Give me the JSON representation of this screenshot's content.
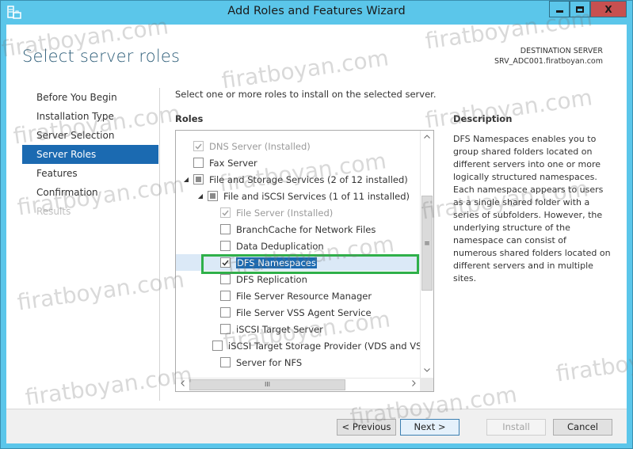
{
  "window": {
    "title": "Add Roles and Features Wizard",
    "controls": {
      "minimize": "minimize",
      "maximize": "maximize",
      "close": "X"
    }
  },
  "header": {
    "page_title": "Select server roles",
    "destination_label": "DESTINATION SERVER",
    "destination_server": "SRV_ADC001.firatboyan.com"
  },
  "nav": {
    "items": [
      {
        "label": "Before You Begin",
        "state": "normal"
      },
      {
        "label": "Installation Type",
        "state": "normal"
      },
      {
        "label": "Server Selection",
        "state": "normal"
      },
      {
        "label": "Server Roles",
        "state": "active"
      },
      {
        "label": "Features",
        "state": "normal"
      },
      {
        "label": "Confirmation",
        "state": "normal"
      },
      {
        "label": "Results",
        "state": "disabled"
      }
    ]
  },
  "main": {
    "instruction": "Select one or more roles to install on the selected server.",
    "roles_heading": "Roles",
    "roles": [
      {
        "label": "DNS Server (Installed)",
        "level": 0,
        "check": "checked-disabled",
        "expander": ""
      },
      {
        "label": "Fax Server",
        "level": 0,
        "check": "unchecked",
        "expander": ""
      },
      {
        "label": "File and Storage Services (2 of 12 installed)",
        "level": 0,
        "check": "partial",
        "expander": "◢"
      },
      {
        "label": "File and iSCSI Services (1 of 11 installed)",
        "level": 1,
        "check": "partial",
        "expander": "◢"
      },
      {
        "label": "File Server (Installed)",
        "level": 2,
        "check": "checked-disabled",
        "expander": ""
      },
      {
        "label": "BranchCache for Network Files",
        "level": 2,
        "check": "unchecked",
        "expander": ""
      },
      {
        "label": "Data Deduplication",
        "level": 2,
        "check": "unchecked",
        "expander": ""
      },
      {
        "label": "DFS Namespaces",
        "level": 2,
        "check": "checked",
        "expander": "",
        "selected": true
      },
      {
        "label": "DFS Replication",
        "level": 2,
        "check": "unchecked",
        "expander": ""
      },
      {
        "label": "File Server Resource Manager",
        "level": 2,
        "check": "unchecked",
        "expander": ""
      },
      {
        "label": "File Server VSS Agent Service",
        "level": 2,
        "check": "unchecked",
        "expander": ""
      },
      {
        "label": "iSCSI Target Server",
        "level": 2,
        "check": "unchecked",
        "expander": ""
      },
      {
        "label": "iSCSI Target Storage Provider (VDS and VSS",
        "level": 2,
        "check": "unchecked",
        "expander": ""
      },
      {
        "label": "Server for NFS",
        "level": 2,
        "check": "unchecked",
        "expander": ""
      }
    ],
    "scrollbar": {
      "up": "^",
      "down": "v",
      "left": "<",
      "right": ">",
      "grip_v": "≡",
      "grip_h": "III"
    }
  },
  "description": {
    "heading": "Description",
    "text": "DFS Namespaces enables you to group shared folders located on different servers into one or more logically structured namespaces. Each namespace appears to users as a single shared folder with a series of subfolders. However, the underlying structure of the namespace can consist of numerous shared folders located on different servers and in multiple sites."
  },
  "footer": {
    "previous": "< Previous",
    "next": "Next >",
    "install": "Install",
    "cancel": "Cancel"
  },
  "watermark": "firatboyan.com",
  "colors": {
    "titlebar": "#5bc6ea",
    "accent": "#1b6ab1",
    "close": "#c75050",
    "highlight": "#2fb04a"
  }
}
